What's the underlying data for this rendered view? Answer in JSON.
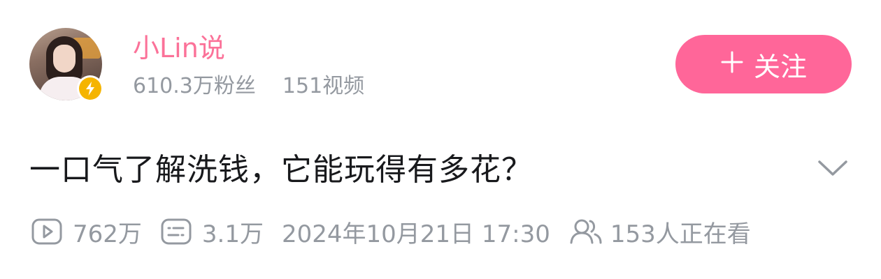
{
  "author": {
    "name": "小Lin说",
    "followers": "610.3万粉丝",
    "videos": "151视频",
    "avatar_icon": "avatar-photo",
    "badge_icon": "verified-lightning-icon",
    "badge_color": "#f5b400"
  },
  "follow_button": {
    "label": "关注",
    "icon": "plus-icon",
    "color": "#ff6699"
  },
  "video": {
    "title": "一口气了解洗钱，它能玩得有多花？",
    "expand_icon": "chevron-down-icon",
    "views": "762万",
    "comments": "3.1万",
    "publish_time": "2024年10月21日 17:30",
    "watching": "153人正在看"
  },
  "colors": {
    "name_pink": "#fb7299",
    "meta_gray": "#9499a0",
    "title_black": "#18191c"
  }
}
